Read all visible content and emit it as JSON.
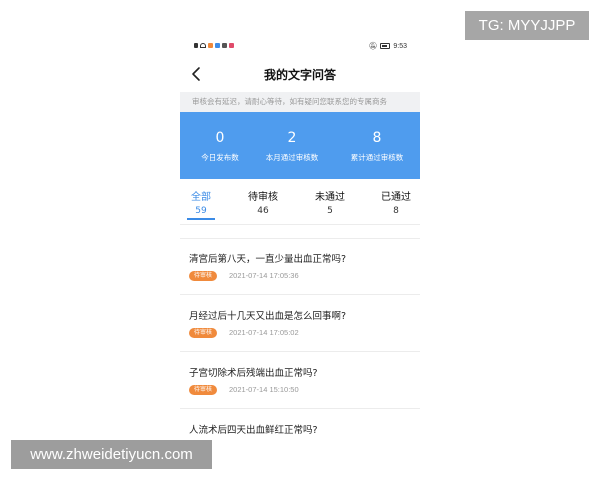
{
  "watermarks": {
    "tg": "TG: MYYJJPP",
    "site": "www.zhweidetiyucn.com"
  },
  "status_bar": {
    "time": "9:53"
  },
  "header": {
    "title": "我的文字问答"
  },
  "notice": "审核会有延迟，请耐心等待，如有疑问您联系您的专属商务",
  "stats": [
    {
      "value": "0",
      "label": "今日发布数"
    },
    {
      "value": "2",
      "label": "本月通过审核数"
    },
    {
      "value": "8",
      "label": "累计通过审核数"
    }
  ],
  "tabs": [
    {
      "label": "全部",
      "count": "59",
      "active": true
    },
    {
      "label": "待审核",
      "count": "46",
      "active": false
    },
    {
      "label": "未通过",
      "count": "5",
      "active": false
    },
    {
      "label": "已通过",
      "count": "8",
      "active": false
    }
  ],
  "questions": [
    {
      "title": "清宫后第八天，一直少量出血正常吗?",
      "status": "待审核",
      "time": "2021-07-14 17:05:36"
    },
    {
      "title": "月经过后十几天又出血是怎么回事啊?",
      "status": "待审核",
      "time": "2021-07-14 17:05:02"
    },
    {
      "title": "子宫切除术后残端出血正常吗?",
      "status": "待审核",
      "time": "2021-07-14 15:10:50"
    },
    {
      "title": "人流术后四天出血鲜红正常吗?",
      "status": "",
      "time": ""
    }
  ],
  "colors": {
    "accent": "#3b8be6",
    "stats_bg": "#4f9cee",
    "badge": "#f08a3c"
  }
}
